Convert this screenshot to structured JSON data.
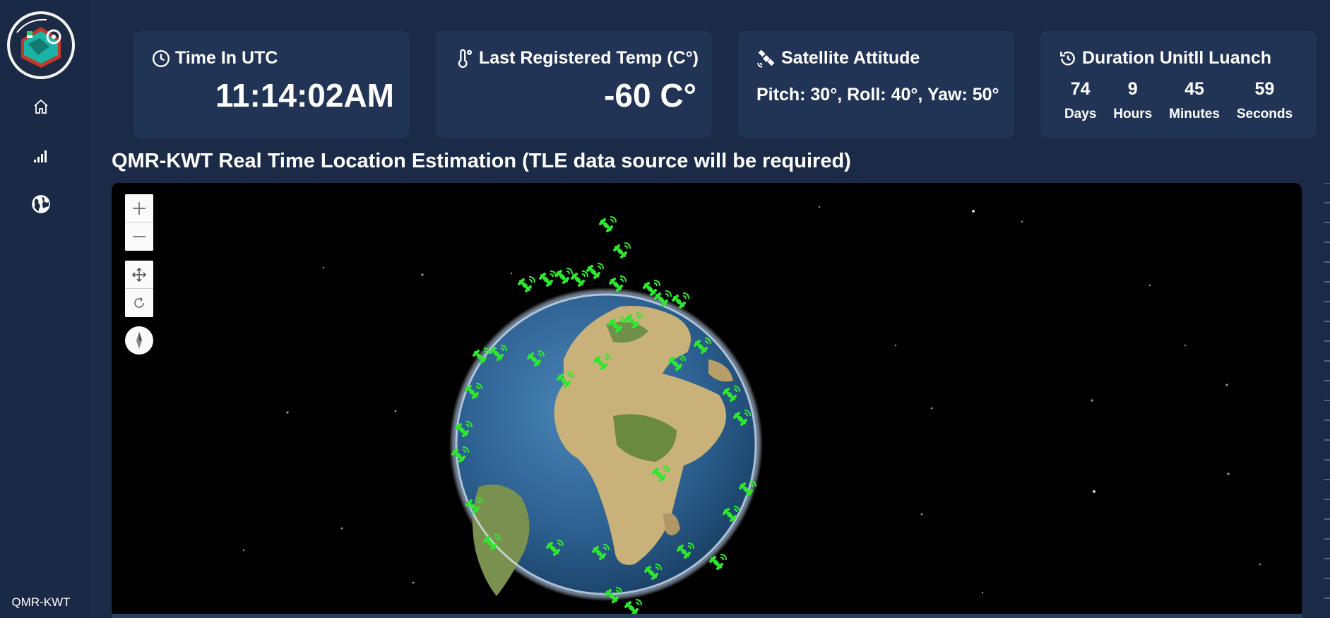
{
  "app": {
    "brand": "QMR-KWT"
  },
  "sidebar": {
    "items": [
      {
        "icon": "home-icon"
      },
      {
        "icon": "signal-bars-icon"
      },
      {
        "icon": "globe-icon"
      }
    ]
  },
  "cards": {
    "time": {
      "title": "Time In UTC",
      "value": "11:14:02AM",
      "icon": "clock-icon"
    },
    "temp": {
      "title": "Last Registered Temp (C°)",
      "value": "-60 C°",
      "icon": "thermometer-icon"
    },
    "attitude": {
      "title": "Satellite Attitude",
      "value": "Pitch: 30°, Roll: 40°, Yaw: 50°",
      "icon": "satellite-icon"
    },
    "countdown": {
      "title": "Duration Unitll Luanch",
      "icon": "history-icon",
      "units": [
        {
          "num": "74",
          "label": "Days"
        },
        {
          "num": "9",
          "label": "Hours"
        },
        {
          "num": "45",
          "label": "Minutes"
        },
        {
          "num": "59",
          "label": "Seconds"
        }
      ]
    }
  },
  "map": {
    "title": "QMR-KWT Real Time Location Estimation (TLE data source will be required)",
    "satellite_color": "#2ee82e",
    "controls": [
      "zoom-in-icon",
      "zoom-out-icon",
      "pan-icon",
      "rotate-icon",
      "compass-icon"
    ]
  },
  "colors": {
    "background": "#1b2a47",
    "card": "#223456",
    "sidebar": "#1a2945"
  }
}
